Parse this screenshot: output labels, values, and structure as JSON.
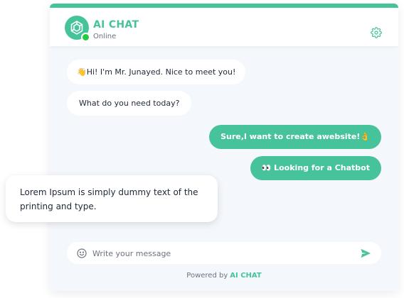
{
  "header": {
    "title": "AI CHAT",
    "status": "Online"
  },
  "messages": [
    {
      "from": "bot",
      "text": "👋Hi! I'm Mr. Junayed. Nice to meet you!"
    },
    {
      "from": "bot",
      "text": "What do you need today?"
    },
    {
      "from": "user",
      "text": "Sure,I want to create awebsite!👌"
    },
    {
      "from": "user",
      "text": "👀 Looking for a Chatbot"
    }
  ],
  "overlay": {
    "text": "Lorem Ipsum is simply dummy text of the printing and type."
  },
  "composer": {
    "placeholder": "Write your message",
    "value": ""
  },
  "footer": {
    "powered_prefix": "Powered by",
    "powered_brand": "AI CHAT"
  },
  "colors": {
    "accent": "#46c39b",
    "online": "#27c93f",
    "background": "#f4f7fb"
  },
  "icons": {
    "avatar": "ai-logo-icon",
    "settings": "gear-icon",
    "emoji": "smiley-icon",
    "send": "send-icon"
  }
}
